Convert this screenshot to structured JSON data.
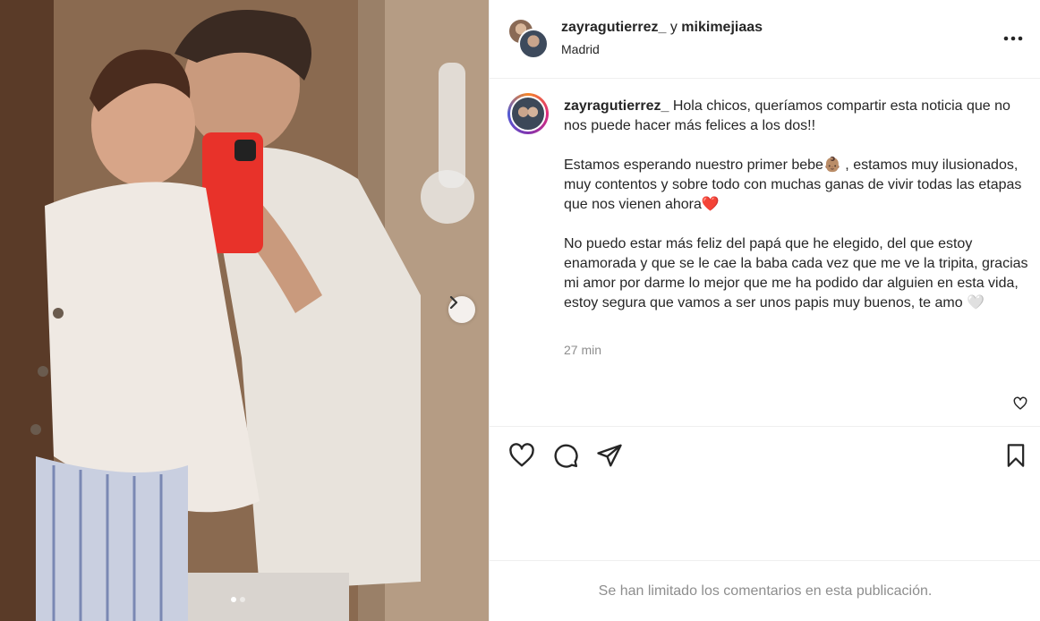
{
  "photo": {
    "alt_icon": "chevron-right-icon",
    "carousel_dots": 2,
    "active_dot": 1
  },
  "header": {
    "user1": "zayragutierrez_",
    "joiner": "y",
    "user2": "mikimejiaas",
    "location": "Madrid",
    "more_icon": "more-horizontal-icon"
  },
  "caption": {
    "username": "zayragutierrez_",
    "p1": "Hola chicos, queríamos compartir esta noticia que no nos puede hacer más felices a los dos!!",
    "p2": "Estamos esperando nuestro primer bebe👶🏽 , estamos muy ilusionados, muy contentos y sobre todo con muchas ganas de vivir todas las etapas que nos vienen ahora❤️",
    "p3": "No puedo estar más feliz del papá que he elegido, del que estoy enamorada y que se le cae la baba cada vez que me ve la tripita, gracias mi amor por darme lo mejor que me ha podido dar alguien en esta vida, estoy segura que vamos a ser unos papis muy buenos, te amo 🤍",
    "time": "27 min"
  },
  "actions": {
    "like_icon": "heart-icon",
    "comment_icon": "comment-icon",
    "share_icon": "send-icon",
    "save_icon": "bookmark-icon"
  },
  "footer": {
    "comments_limited": "Se han limitado los comentarios en esta publicación."
  }
}
